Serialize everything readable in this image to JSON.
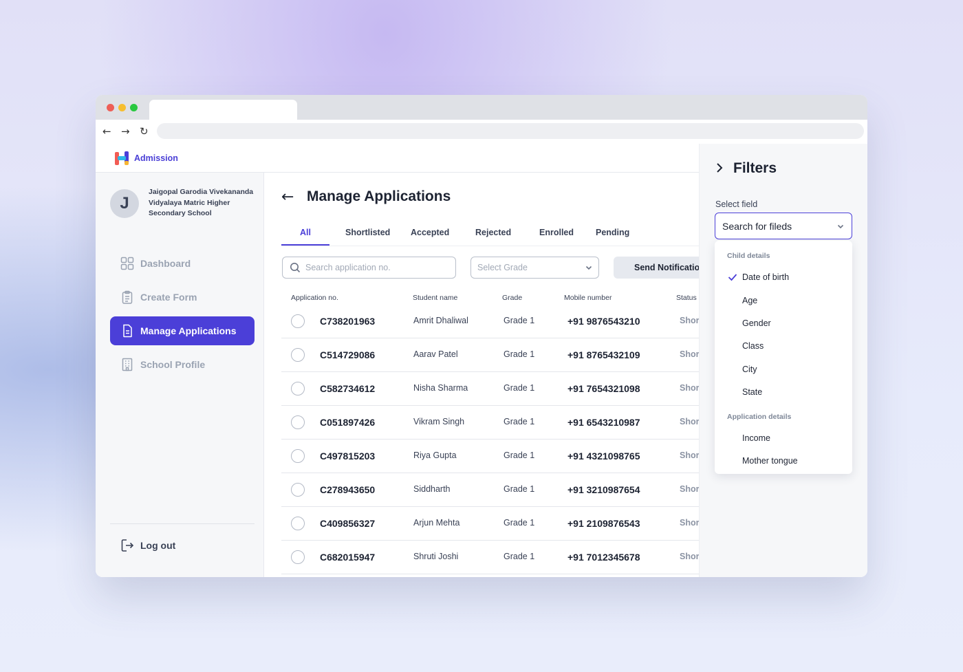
{
  "brand": {
    "name": "Admission",
    "colors": {
      "accent": "#4b3fd8",
      "logo": [
        "#f25c54",
        "#4b3fd8",
        "#2fb8e8",
        "#f7b733"
      ]
    }
  },
  "sidebar": {
    "avatar_initial": "J",
    "school_name": "Jaigopal Garodia Vivekananda Vidyalaya Matric Higher Secondary School",
    "items": [
      {
        "label": "Dashboard",
        "icon": "dashboard-icon",
        "active": false
      },
      {
        "label": "Create Form",
        "icon": "clipboard-icon",
        "active": false
      },
      {
        "label": "Manage Applications",
        "icon": "document-icon",
        "active": true
      },
      {
        "label": "School Profile",
        "icon": "building-icon",
        "active": false
      }
    ],
    "logout_label": "Log out"
  },
  "main": {
    "title": "Manage Applications",
    "tabs": [
      "All",
      "Shortlisted",
      "Accepted",
      "Rejected",
      "Enrolled",
      "Pending"
    ],
    "active_tab": "All",
    "search_placeholder": "Search application no.",
    "grade_placeholder": "Select Grade",
    "send_button": "Send Notificatio",
    "columns": [
      "Application no.",
      "Student name",
      "Grade",
      "Mobile number",
      "Status"
    ],
    "rows": [
      {
        "app": "C738201963",
        "name": "Amrit Dhaliwal",
        "grade": "Grade 1",
        "mobile": "+91 9876543210",
        "status": "Shor"
      },
      {
        "app": "C514729086",
        "name": "Aarav Patel",
        "grade": "Grade 1",
        "mobile": "+91 8765432109",
        "status": "Shor"
      },
      {
        "app": "C582734612",
        "name": "Nisha Sharma",
        "grade": "Grade 1",
        "mobile": "+91 7654321098",
        "status": "Shor"
      },
      {
        "app": "C051897426",
        "name": "Vikram Singh",
        "grade": "Grade 1",
        "mobile": "+91 6543210987",
        "status": "Shor"
      },
      {
        "app": "C497815203",
        "name": "Riya Gupta",
        "grade": "Grade 1",
        "mobile": "+91 4321098765",
        "status": "Shor"
      },
      {
        "app": "C278943650",
        "name": "Siddharth",
        "grade": "Grade 1",
        "mobile": "+91 3210987654",
        "status": "Shor"
      },
      {
        "app": "C409856327",
        "name": "Arjun Mehta",
        "grade": "Grade 1",
        "mobile": "+91 2109876543",
        "status": "Shor"
      },
      {
        "app": "C682015947",
        "name": "Shruti Joshi",
        "grade": "Grade 1",
        "mobile": "+91 7012345678",
        "status": "Shor"
      }
    ]
  },
  "filters": {
    "title": "Filters",
    "select_label": "Select field",
    "search_value": "Search for fileds",
    "groups": [
      {
        "label": "Child details",
        "items": [
          "Date of birth",
          "Age",
          "Gender",
          "Class",
          "City",
          "State"
        ]
      },
      {
        "label": "Application details",
        "items": [
          "Income",
          "Mother tongue"
        ]
      }
    ],
    "checked_item": "Date of birth"
  }
}
